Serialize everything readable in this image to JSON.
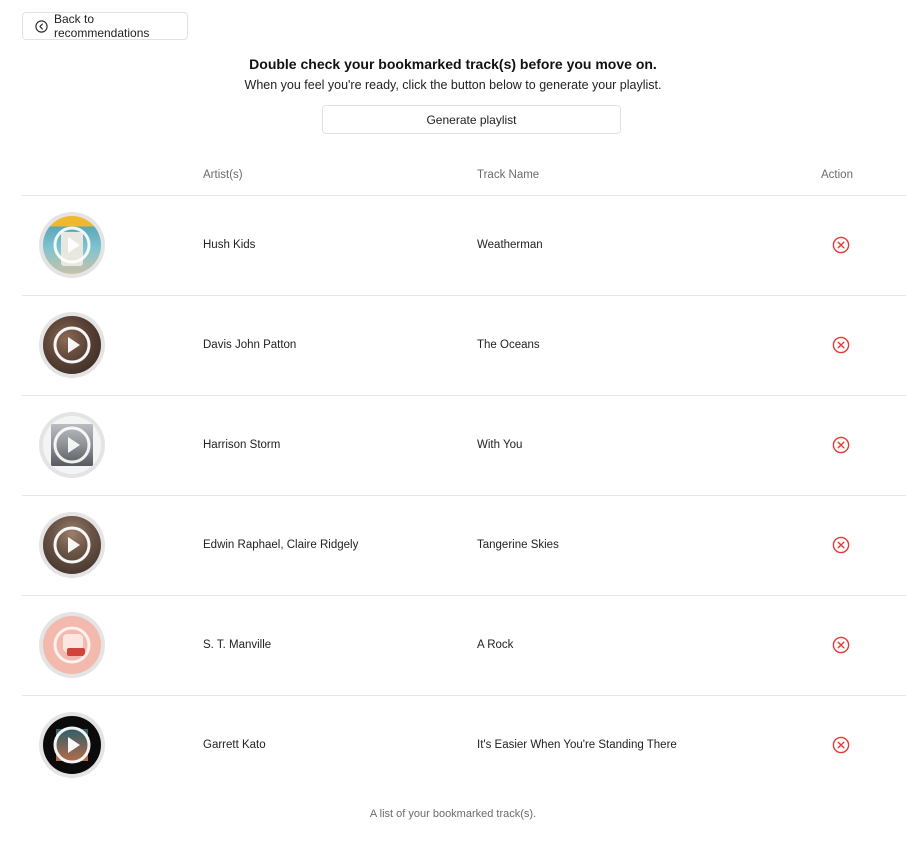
{
  "back_button": {
    "label": "Back to recommendations",
    "icon": "arrow-left-circle-icon"
  },
  "heading": "Double check your bookmarked track(s) before you move on.",
  "subheading": "When you feel you're ready, click the button below to generate your playlist.",
  "generate_button": {
    "label": "Generate playlist"
  },
  "table": {
    "headers": {
      "artists": "Artist(s)",
      "track": "Track Name",
      "action": "Action"
    },
    "rows": [
      {
        "artist": "Hush Kids",
        "track": "Weatherman"
      },
      {
        "artist": "Davis John Patton",
        "track": "The Oceans"
      },
      {
        "artist": "Harrison Storm",
        "track": "With You"
      },
      {
        "artist": "Edwin Raphael, Claire Ridgely",
        "track": "Tangerine Skies"
      },
      {
        "artist": "S. T. Manville",
        "track": "A Rock"
      },
      {
        "artist": "Garrett Kato",
        "track": "It's Easier When You're Standing There"
      }
    ],
    "caption": "A list of your bookmarked track(s)."
  },
  "colors": {
    "remove_icon": "#e53935",
    "border": "#e2e2e2",
    "muted_text": "#6b6b6b"
  },
  "icons": {
    "play": "play-circle-icon",
    "remove": "x-circle-icon"
  }
}
